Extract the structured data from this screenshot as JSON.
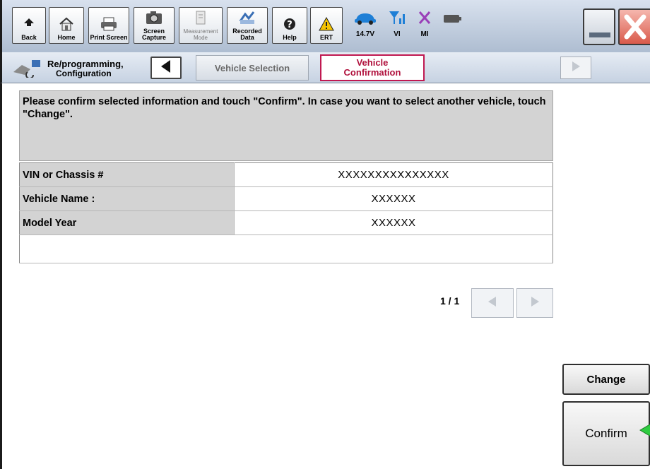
{
  "toolbar": {
    "buttons": [
      {
        "label": "Back",
        "icon": "back-arrow-icon"
      },
      {
        "label": "Home",
        "icon": "home-icon"
      },
      {
        "label": "Print Screen",
        "icon": "printer-icon"
      },
      {
        "label": "Screen Capture",
        "icon": "camera-icon"
      },
      {
        "label": "Measurement Mode",
        "icon": "measurement-icon"
      },
      {
        "label": "Recorded Data",
        "icon": "recorded-data-icon"
      },
      {
        "label": "Help",
        "icon": "help-icon"
      },
      {
        "label": "ERT",
        "icon": "warning-icon"
      }
    ],
    "status": [
      {
        "label": "14.7V",
        "icon": "car-battery-icon"
      },
      {
        "label": "VI",
        "icon": "signal-icon"
      },
      {
        "label": "MI",
        "icon": "x-mark-icon"
      }
    ]
  },
  "nav": {
    "breadcrumb_line1": "Re/programming,",
    "breadcrumb_line2": "Configuration",
    "tab_previous": "Vehicle Selection",
    "tab_current_line1": "Vehicle",
    "tab_current_line2": "Confirmation"
  },
  "message": "Please confirm selected information and touch \"Confirm\". In case you want to select another vehicle, touch \"Change\".",
  "table": {
    "rows": [
      {
        "label": "VIN or Chassis #",
        "value": "XXXXXXXXXXXXXXX"
      },
      {
        "label": "Vehicle Name :",
        "value": "XXXXXX"
      },
      {
        "label": "Model Year",
        "value": "XXXXXX"
      }
    ]
  },
  "pager": {
    "text": "1 / 1"
  },
  "actions": {
    "change": "Change",
    "confirm": "Confirm"
  },
  "colors": {
    "accent": "#c01850",
    "pointer": "#2ecc40"
  }
}
